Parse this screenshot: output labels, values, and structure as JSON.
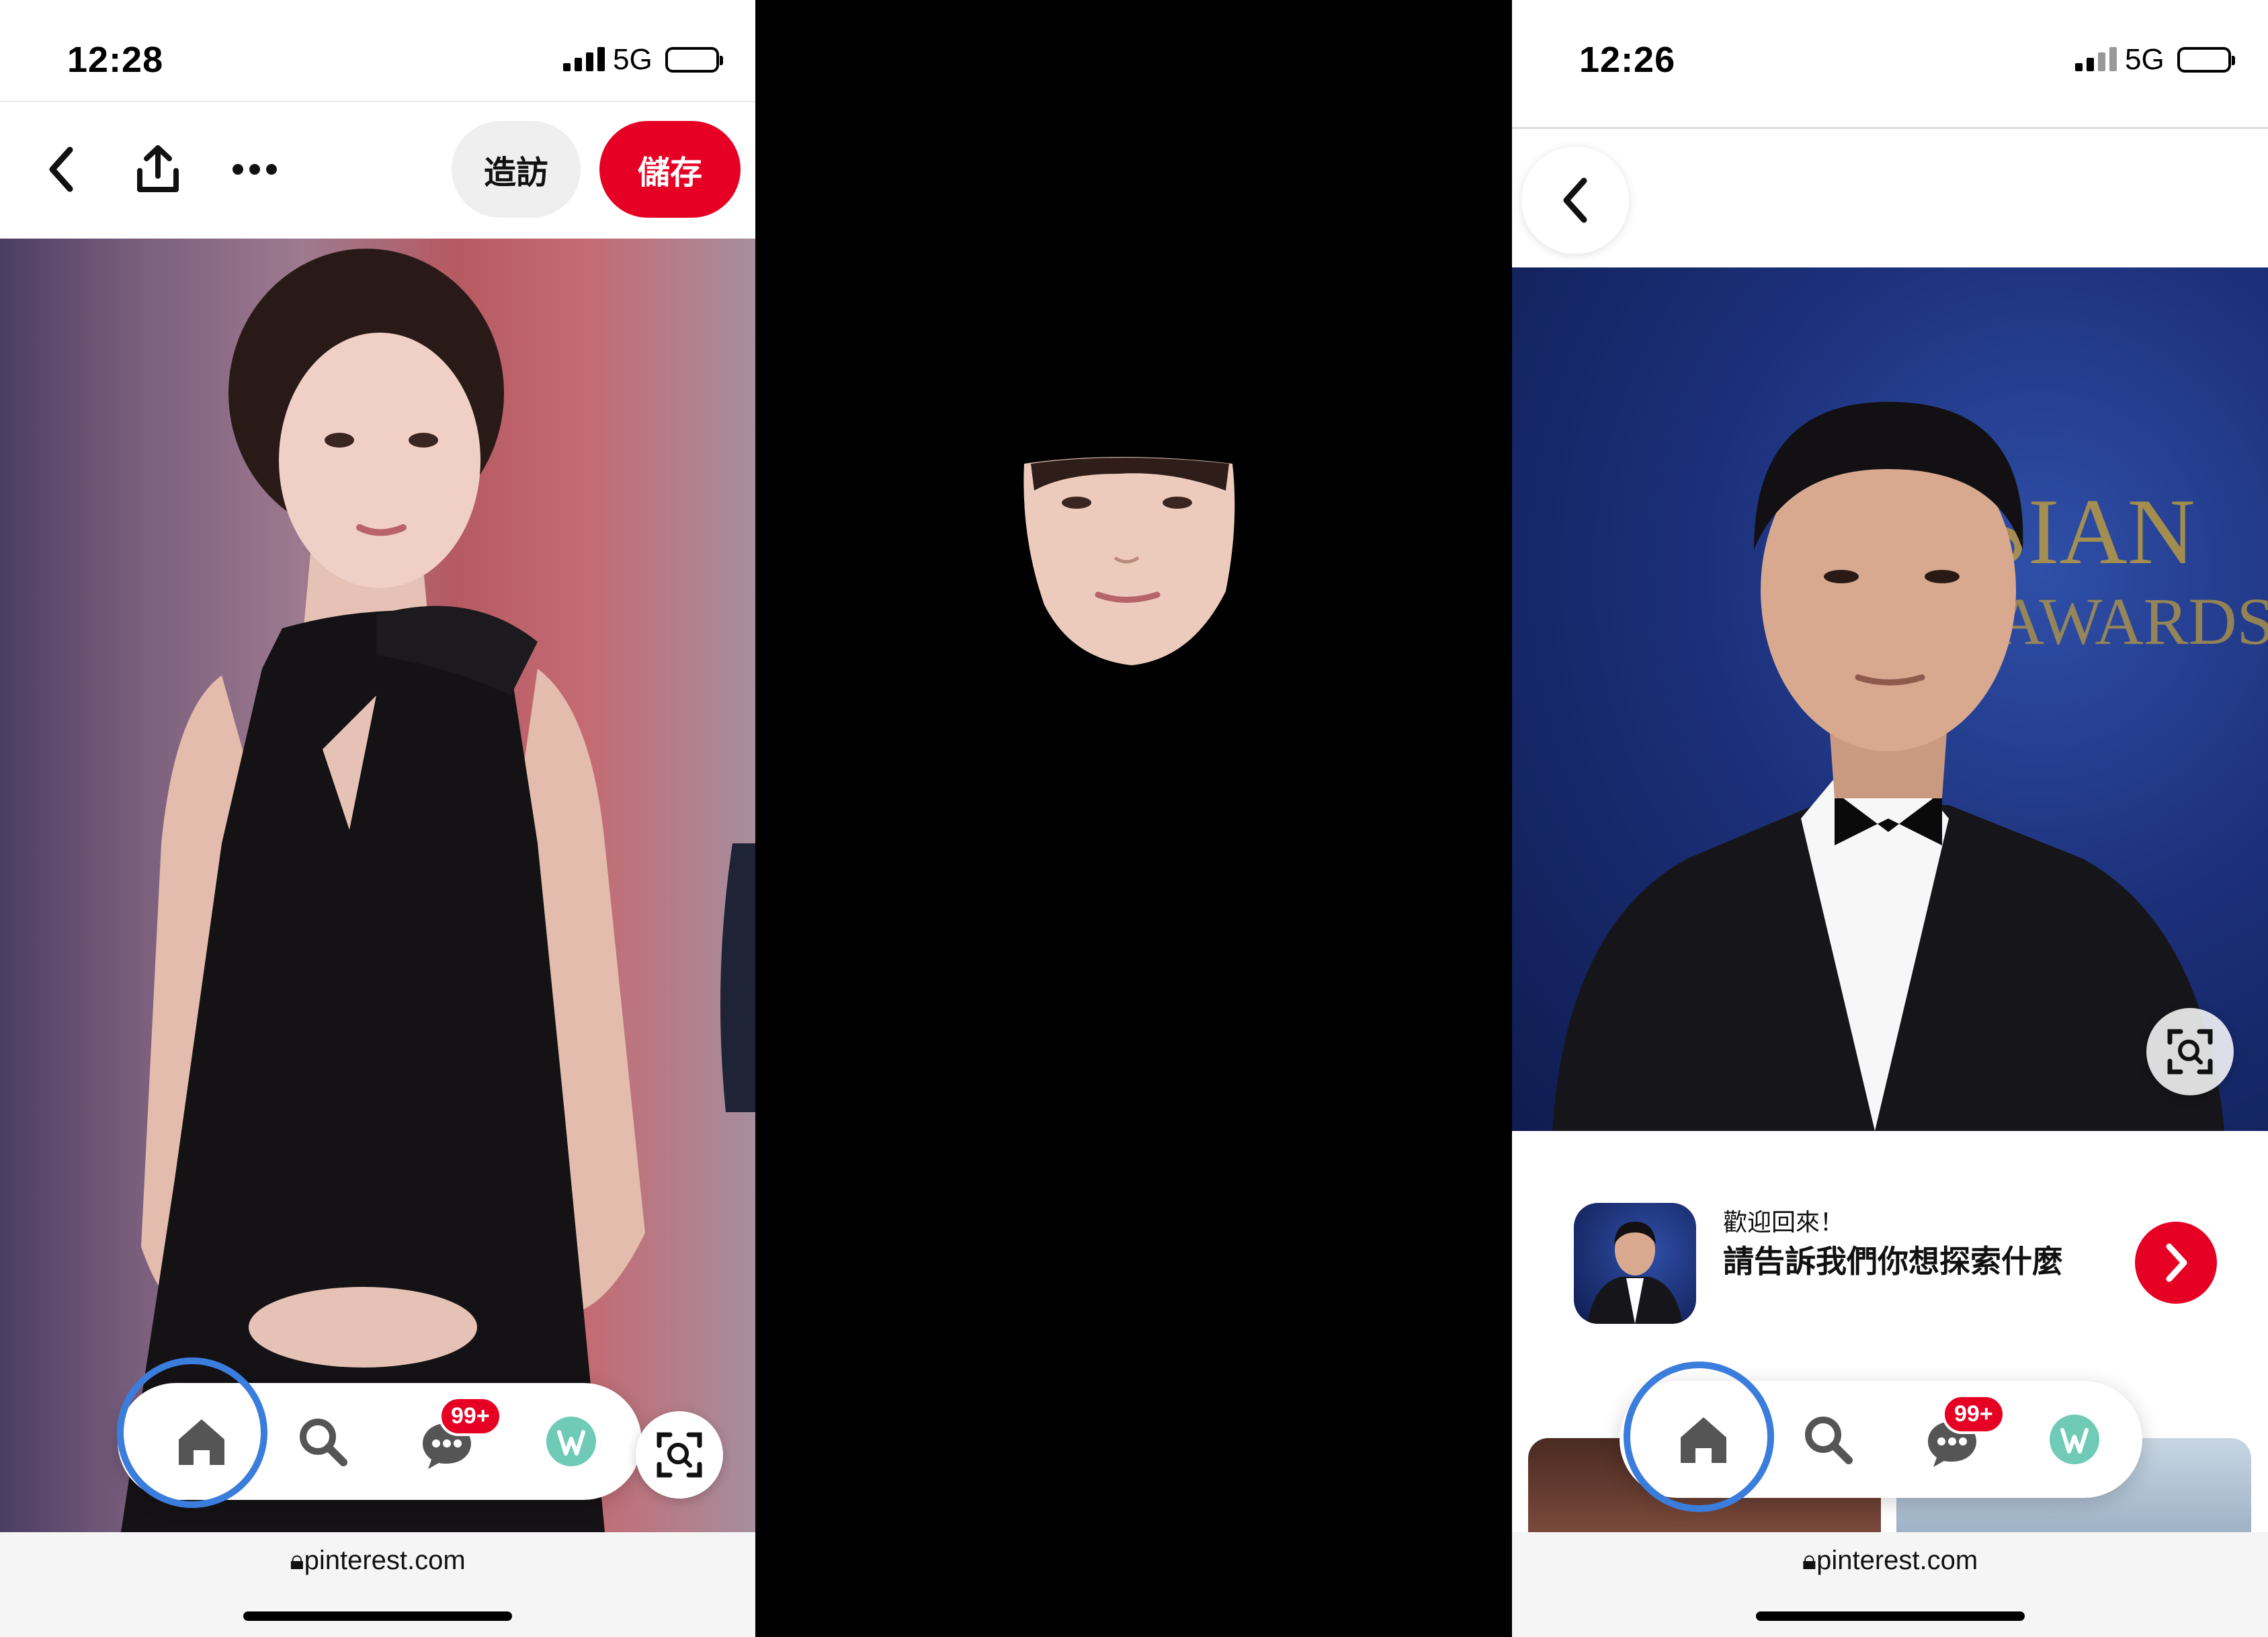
{
  "left": {
    "time": "12:28",
    "network": "5G",
    "visit_label": "造訪",
    "save_label": "儲存",
    "badge": "99+",
    "url": "pinterest.com"
  },
  "right": {
    "time": "12:26",
    "network": "5G",
    "welcome_greeting": "歡迎回來！",
    "welcome_prompt": "請告訴我們你想探索什麼",
    "badge": "99+",
    "url": "pinterest.com"
  },
  "colors": {
    "brand_red": "#e60023",
    "highlight_ring": "#3b7ddd"
  },
  "icons": [
    "back-chevron-icon",
    "share-icon",
    "more-icon",
    "home-icon",
    "search-icon",
    "messages-icon",
    "profile-icon",
    "visual-search-icon",
    "lock-icon",
    "chevron-right-icon"
  ]
}
